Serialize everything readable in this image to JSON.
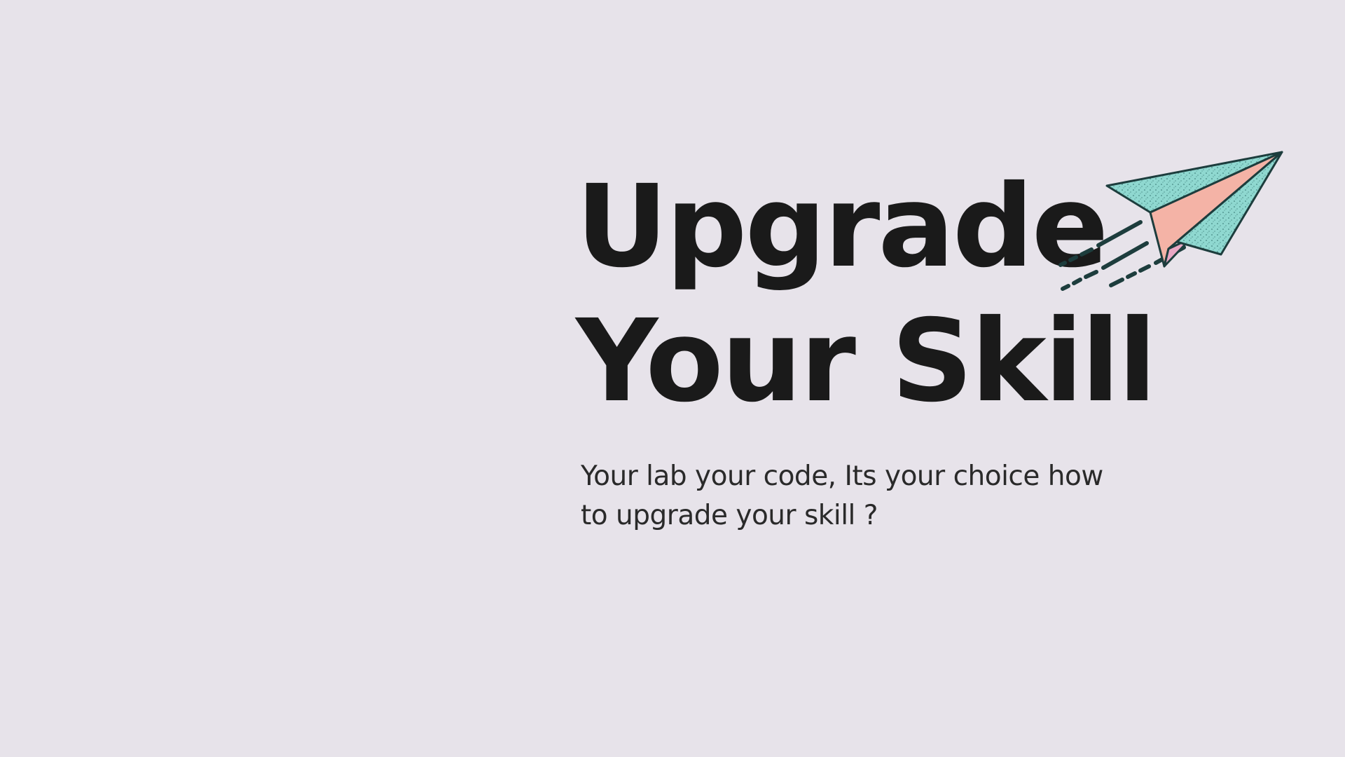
{
  "hero": {
    "headline_line1": "Upgrade",
    "headline_line2": "Your Skill",
    "tagline": "Your lab your code, Its your choice how to upgrade your skill ?"
  },
  "illustration": {
    "icon": "paper-plane-icon"
  },
  "colors": {
    "background": "#e7e3ea",
    "text": "#1a1a1a",
    "plane_teal": "#8fd8d0",
    "plane_pink": "#f4b3a6",
    "outline": "#1d3d3d"
  }
}
